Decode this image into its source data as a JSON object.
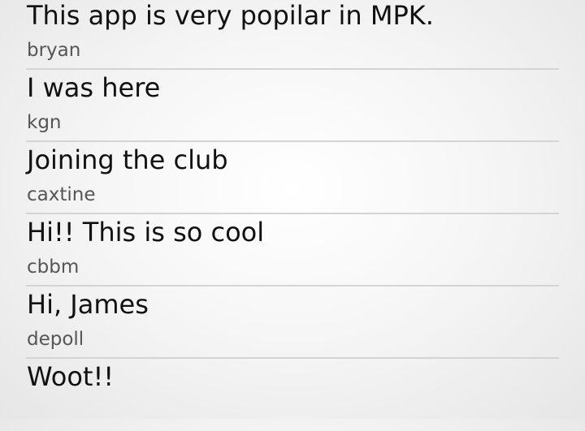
{
  "posts": [
    {
      "text": "This app is very popilar in MPK.",
      "user": "bryan"
    },
    {
      "text": "I was here",
      "user": "kgn"
    },
    {
      "text": "Joining the club",
      "user": "caxtine"
    },
    {
      "text": "Hi!! This is so cool",
      "user": "cbbm"
    },
    {
      "text": "Hi, James",
      "user": "depoll"
    },
    {
      "text": "Woot!!",
      "user": ""
    }
  ]
}
